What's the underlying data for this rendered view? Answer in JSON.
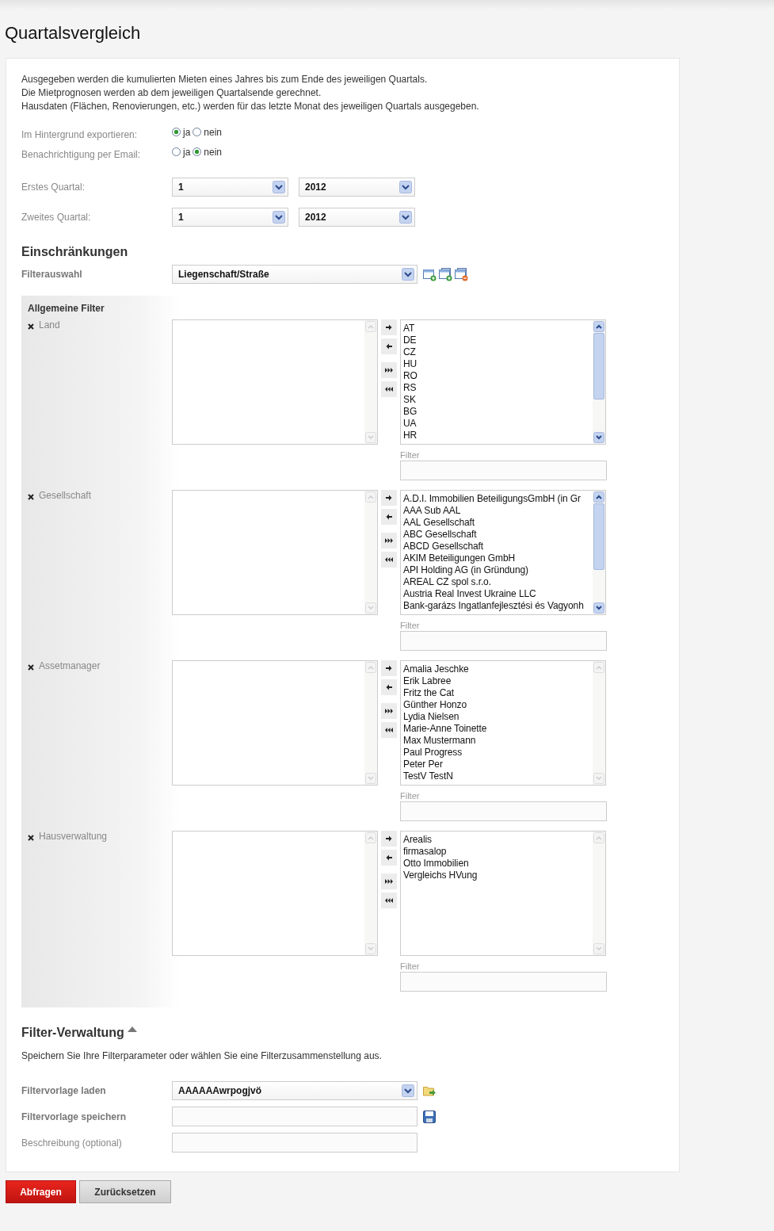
{
  "page": {
    "title": "Quartalsvergleich"
  },
  "intro": [
    "Ausgegeben werden die kumulierten Mieten eines Jahres bis zum Ende des jeweiligen Quartals.",
    "Die Mietprognosen werden ab dem jeweiligen Quartalsende gerechnet.",
    "Hausdaten (Flächen, Renovierungen, etc.) werden für das letzte Monat des jeweiligen Quartals ausgegeben."
  ],
  "options": [
    {
      "label": "Im Hintergrund exportieren:",
      "choices": [
        {
          "label": "ja",
          "selected": true
        },
        {
          "label": "nein",
          "selected": false
        }
      ]
    },
    {
      "label": "Benachrichtigung per Email:",
      "choices": [
        {
          "label": "ja",
          "selected": false
        },
        {
          "label": "nein",
          "selected": true
        }
      ]
    }
  ],
  "quarters": [
    {
      "label": "Erstes Quartal:",
      "quarter": "1",
      "year": "2012"
    },
    {
      "label": "Zweites Quartal:",
      "quarter": "1",
      "year": "2012"
    }
  ],
  "restrictions": {
    "heading": "Einschränkungen",
    "filter_select": {
      "label": "Filterauswahl",
      "value": "Liegenschaft/Straße"
    },
    "panel_title": "Allgemeine Filter",
    "filters": [
      {
        "label": "Land",
        "filter_label": "Filter",
        "scrollable": true,
        "items": [
          "AT",
          "DE",
          "CZ",
          "HU",
          "RO",
          "RS",
          "SK",
          "BG",
          "UA",
          "HR"
        ]
      },
      {
        "label": "Gesellschaft",
        "filter_label": "Filter",
        "scrollable": true,
        "items": [
          "A.D.I. Immobilien BeteiligungsGmbH (in Gr",
          "AAA Sub AAL",
          "AAL Gesellschaft",
          "ABC Gesellschaft",
          "ABCD Gesellschaft",
          "AKIM Beteiligungen GmbH",
          "API Holding AG (in Gründung)",
          "AREAL CZ spol s.r.o.",
          "Austria Real Invest Ukraine LLC",
          "Bank-garázs Ingatlanfejlesztési és Vagyonh"
        ]
      },
      {
        "label": "Assetmanager",
        "filter_label": "Filter",
        "scrollable": false,
        "items": [
          "Amalia Jeschke",
          "Erik Labree",
          "Fritz the Cat",
          "Günther Honzo",
          "Lydia Nielsen",
          "Marie-Anne Toinette",
          "Max Mustermann",
          "Paul Progress",
          "Peter Per",
          "TestV TestN"
        ]
      },
      {
        "label": "Hausverwaltung",
        "filter_label": "Filter",
        "scrollable": false,
        "items": [
          "Arealis",
          "firmasalop",
          "Otto Immobilien",
          "Vergleichs HVung"
        ]
      }
    ]
  },
  "filter_management": {
    "heading": "Filter-Verwaltung",
    "expanded": true,
    "description": "Speichern Sie Ihre Filterparameter oder wählen Sie eine Filterzusammenstellung aus.",
    "rows": [
      {
        "kind": "load",
        "label": "Filtervorlage laden",
        "bold": true,
        "value": "AAAAAAwrpogjvö"
      },
      {
        "kind": "save",
        "label": "Filtervorlage speichern",
        "bold": true
      },
      {
        "kind": "text",
        "label": "Beschreibung (optional)",
        "bold": false
      }
    ]
  },
  "buttons": [
    {
      "label": "Abfragen",
      "kind": "primary"
    },
    {
      "label": "Zurücksetzen",
      "kind": "secondary"
    }
  ]
}
